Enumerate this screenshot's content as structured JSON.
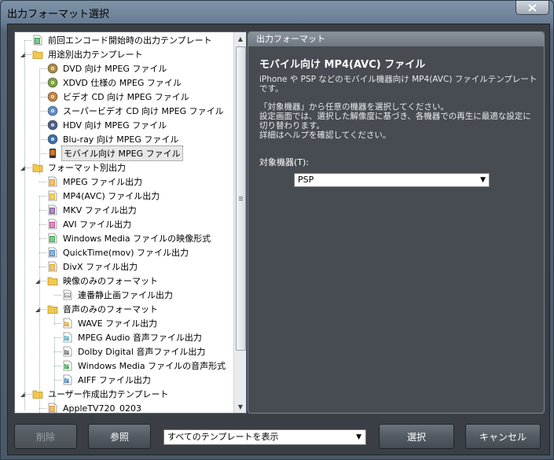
{
  "window": {
    "title": "出力フォーマット選択",
    "close_label": "✕"
  },
  "tree": {
    "items": [
      {
        "label": "前回エンコード開始時の出力テンプレート",
        "icon": "template-doc-icon",
        "color": "#2fa84f"
      },
      {
        "label": "用途別出力テンプレート",
        "icon": "folder-icon",
        "color": "#f2c94c"
      },
      {
        "label": "DVD 向け MPEG ファイル",
        "icon": "disc-icon",
        "color": "#b08a3c"
      },
      {
        "label": "XDVD 仕様の MPEG ファイル",
        "icon": "disc-icon",
        "color": "#7aa33a"
      },
      {
        "label": "ビデオ CD 向け MPEG ファイル",
        "icon": "disc-icon",
        "color": "#c9823a"
      },
      {
        "label": "スーパービデオ CD 向け MPEG ファイル",
        "icon": "disc-icon",
        "color": "#5b8cc9"
      },
      {
        "label": "HDV 向け MPEG ファイル",
        "icon": "disc-icon",
        "color": "#4a5f8c"
      },
      {
        "label": "Blu-ray 向け MPEG ファイル",
        "icon": "disc-icon",
        "color": "#3a6fb0"
      },
      {
        "label": "モバイル向け MPEG ファイル",
        "icon": "mobile-icon",
        "color": "#d2782c"
      },
      {
        "label": "フォーマット別出力",
        "icon": "folder-icon",
        "color": "#f2c94c"
      },
      {
        "label": "MPEG ファイル出力",
        "icon": "file-icon",
        "color": "#e39a2b"
      },
      {
        "label": "MP4(AVC) ファイル出力",
        "icon": "file-icon",
        "color": "#e3b12b"
      },
      {
        "label": "MKV ファイル出力",
        "icon": "file-icon",
        "color": "#7a4f9a"
      },
      {
        "label": "AVI ファイル出力",
        "icon": "file-icon",
        "color": "#c44e9a"
      },
      {
        "label": "Windows Media ファイルの映像形式",
        "icon": "file-icon",
        "color": "#3aa84f"
      },
      {
        "label": "QuickTime(mov) ファイル出力",
        "icon": "file-icon",
        "color": "#4b86c9"
      },
      {
        "label": "DivX ファイル出力",
        "icon": "file-icon",
        "color": "#e0a62b"
      },
      {
        "label": "映像のみのフォーマット",
        "icon": "folder-icon",
        "color": "#f2c94c"
      },
      {
        "label": "連番静止画ファイル出力",
        "icon": "image-file-icon",
        "color": "#b0b0b0"
      },
      {
        "label": "音声のみのフォーマット",
        "icon": "folder-icon",
        "color": "#f2c94c"
      },
      {
        "label": "WAVE ファイル出力",
        "icon": "audio-file-icon",
        "color": "#e0a62b"
      },
      {
        "label": "MPEG Audio 音声ファイル出力",
        "icon": "audio-file-icon",
        "color": "#4bb0c9"
      },
      {
        "label": "Dolby Digital 音声ファイル出力",
        "icon": "audio-file-icon",
        "color": "#777777"
      },
      {
        "label": "Windows Media ファイルの音声形式",
        "icon": "audio-file-icon",
        "color": "#3aa84f"
      },
      {
        "label": "AIFF ファイル出力",
        "icon": "audio-file-icon",
        "color": "#4b86c9"
      },
      {
        "label": "ユーザー作成出力テンプレート",
        "icon": "folder-icon",
        "color": "#f2c94c"
      },
      {
        "label": "AppleTV720_0203",
        "icon": "file-icon",
        "color": "#e39a2b"
      }
    ]
  },
  "panel": {
    "header": "出力フォーマット",
    "title": "モバイル向け MP4(AVC) ファイル",
    "desc1": "iPhone や PSP などのモバイル機器向け MP4(AVC) ファイルテンプレートです。",
    "desc2_line1": "「対象機器」から任意の機器を選択してください。",
    "desc2_line2": "設定画面では、選択した解像度に基づき、各機器での再生に最適な設定に切り替わります。",
    "desc2_line3": "詳細はヘルプを確認してください。",
    "device_label": "対象機器(T):",
    "device_value": "PSP"
  },
  "footer": {
    "delete_label": "削除",
    "browse_label": "参照",
    "filter_value": "すべてのテンプレートを表示",
    "ok_label": "選択",
    "cancel_label": "キャンセル"
  },
  "colors": {
    "folder": "#f2c94c",
    "panel_bg": "#474c52",
    "window_bg": "#3a3f46"
  }
}
